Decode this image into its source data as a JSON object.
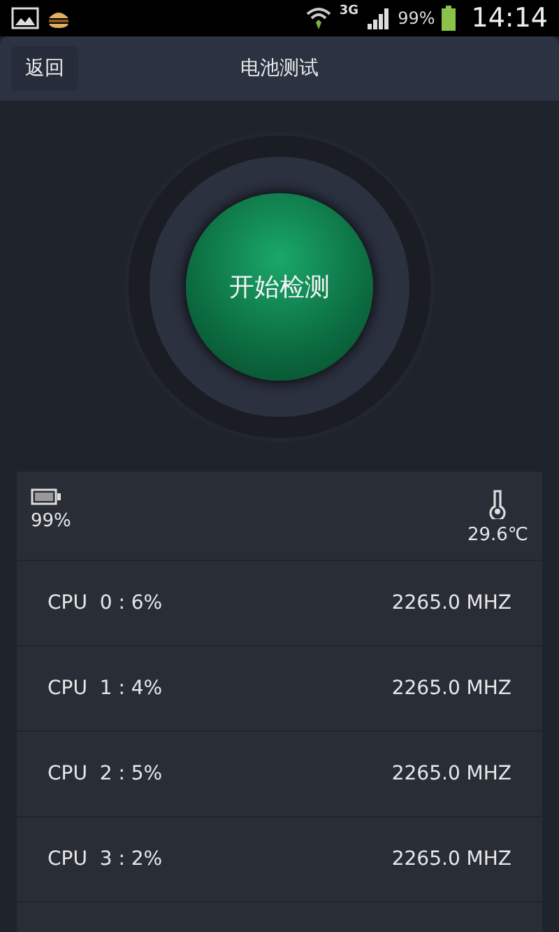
{
  "status_bar": {
    "signal_text": "3G",
    "battery_text": "99%",
    "time": "14:14"
  },
  "header": {
    "back": "返回",
    "title": "电池测试"
  },
  "start_button": {
    "label": "开始检测"
  },
  "info": {
    "battery": "99%",
    "temperature": "29.6℃"
  },
  "cpus": [
    {
      "label": "CPU  0 : 6%",
      "freq": "2265.0 MHZ"
    },
    {
      "label": "CPU  1 : 4%",
      "freq": "2265.0 MHZ"
    },
    {
      "label": "CPU  2 : 5%",
      "freq": "2265.0 MHZ"
    },
    {
      "label": "CPU  3 : 2%",
      "freq": "2265.0 MHZ"
    }
  ]
}
